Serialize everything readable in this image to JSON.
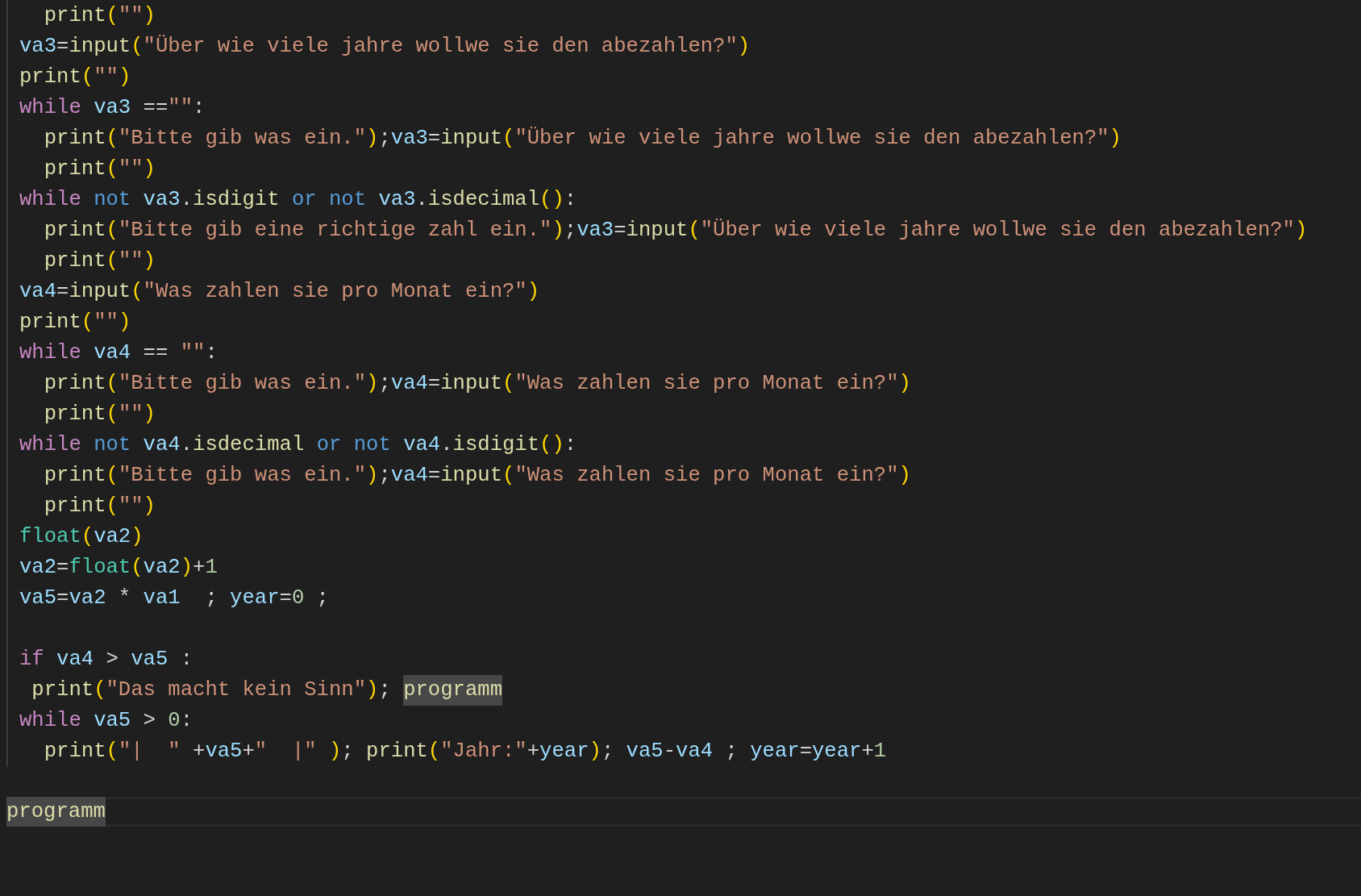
{
  "editor": {
    "lines": [
      {
        "kind": "code",
        "tokens": [
          {
            "kind": "fn",
            "text": "  print"
          },
          {
            "kind": "br",
            "text": "("
          },
          {
            "kind": "str",
            "text": "\"\""
          },
          {
            "kind": "br",
            "text": ")"
          }
        ]
      },
      {
        "kind": "code",
        "tokens": [
          {
            "kind": "var",
            "text": "va3"
          },
          {
            "kind": "p",
            "text": "="
          },
          {
            "kind": "fn",
            "text": "input"
          },
          {
            "kind": "br",
            "text": "("
          },
          {
            "kind": "str",
            "text": "\"Über wie viele jahre wollwe sie den abezahlen?\""
          },
          {
            "kind": "br",
            "text": ")"
          }
        ]
      },
      {
        "kind": "code",
        "tokens": [
          {
            "kind": "fn",
            "text": "print"
          },
          {
            "kind": "br",
            "text": "("
          },
          {
            "kind": "str",
            "text": "\"\""
          },
          {
            "kind": "br",
            "text": ")"
          }
        ]
      },
      {
        "kind": "code",
        "tokens": [
          {
            "kind": "kw",
            "text": "while "
          },
          {
            "kind": "var",
            "text": "va3"
          },
          {
            "kind": "p",
            "text": " =="
          },
          {
            "kind": "str",
            "text": "\"\""
          },
          {
            "kind": "p",
            "text": ":"
          }
        ]
      },
      {
        "kind": "code",
        "tokens": [
          {
            "kind": "fn",
            "text": "  print"
          },
          {
            "kind": "br",
            "text": "("
          },
          {
            "kind": "str",
            "text": "\"Bitte gib was ein.\""
          },
          {
            "kind": "br",
            "text": ")"
          },
          {
            "kind": "p",
            "text": ";"
          },
          {
            "kind": "var",
            "text": "va3"
          },
          {
            "kind": "p",
            "text": "="
          },
          {
            "kind": "fn",
            "text": "input"
          },
          {
            "kind": "br",
            "text": "("
          },
          {
            "kind": "str",
            "text": "\"Über wie viele jahre wollwe sie den abezahlen?\""
          },
          {
            "kind": "br",
            "text": ")"
          }
        ]
      },
      {
        "kind": "code",
        "tokens": [
          {
            "kind": "fn",
            "text": "  print"
          },
          {
            "kind": "br",
            "text": "("
          },
          {
            "kind": "str",
            "text": "\"\""
          },
          {
            "kind": "br",
            "text": ")"
          }
        ]
      },
      {
        "kind": "code",
        "tokens": [
          {
            "kind": "kw",
            "text": "while "
          },
          {
            "kind": "op",
            "text": "not "
          },
          {
            "kind": "var",
            "text": "va3"
          },
          {
            "kind": "p",
            "text": "."
          },
          {
            "kind": "fn",
            "text": "isdigit "
          },
          {
            "kind": "op",
            "text": "or not "
          },
          {
            "kind": "var",
            "text": "va3"
          },
          {
            "kind": "p",
            "text": "."
          },
          {
            "kind": "fn",
            "text": "isdecimal"
          },
          {
            "kind": "br",
            "text": "()"
          },
          {
            "kind": "p",
            "text": ":"
          }
        ]
      },
      {
        "kind": "code",
        "tokens": [
          {
            "kind": "fn",
            "text": "  print"
          },
          {
            "kind": "br",
            "text": "("
          },
          {
            "kind": "str",
            "text": "\"Bitte gib eine richtige zahl ein.\""
          },
          {
            "kind": "br",
            "text": ")"
          },
          {
            "kind": "p",
            "text": ";"
          },
          {
            "kind": "var",
            "text": "va3"
          },
          {
            "kind": "p",
            "text": "="
          },
          {
            "kind": "fn",
            "text": "input"
          },
          {
            "kind": "br",
            "text": "("
          },
          {
            "kind": "str",
            "text": "\"Über wie viele jahre wollwe sie den abezahlen?\""
          },
          {
            "kind": "br",
            "text": ")"
          }
        ]
      },
      {
        "kind": "code",
        "tokens": [
          {
            "kind": "fn",
            "text": "  print"
          },
          {
            "kind": "br",
            "text": "("
          },
          {
            "kind": "str",
            "text": "\"\""
          },
          {
            "kind": "br",
            "text": ")"
          }
        ]
      },
      {
        "kind": "code",
        "tokens": [
          {
            "kind": "var",
            "text": "va4"
          },
          {
            "kind": "p",
            "text": "="
          },
          {
            "kind": "fn",
            "text": "input"
          },
          {
            "kind": "br",
            "text": "("
          },
          {
            "kind": "str",
            "text": "\"Was zahlen sie pro Monat ein?\""
          },
          {
            "kind": "br",
            "text": ")"
          }
        ]
      },
      {
        "kind": "code",
        "tokens": [
          {
            "kind": "fn",
            "text": "print"
          },
          {
            "kind": "br",
            "text": "("
          },
          {
            "kind": "str",
            "text": "\"\""
          },
          {
            "kind": "br",
            "text": ")"
          }
        ]
      },
      {
        "kind": "code",
        "tokens": [
          {
            "kind": "kw",
            "text": "while "
          },
          {
            "kind": "var",
            "text": "va4"
          },
          {
            "kind": "p",
            "text": " == "
          },
          {
            "kind": "str",
            "text": "\"\""
          },
          {
            "kind": "p",
            "text": ":"
          }
        ]
      },
      {
        "kind": "code",
        "tokens": [
          {
            "kind": "fn",
            "text": "  print"
          },
          {
            "kind": "br",
            "text": "("
          },
          {
            "kind": "str",
            "text": "\"Bitte gib was ein.\""
          },
          {
            "kind": "br",
            "text": ")"
          },
          {
            "kind": "p",
            "text": ";"
          },
          {
            "kind": "var",
            "text": "va4"
          },
          {
            "kind": "p",
            "text": "="
          },
          {
            "kind": "fn",
            "text": "input"
          },
          {
            "kind": "br",
            "text": "("
          },
          {
            "kind": "str",
            "text": "\"Was zahlen sie pro Monat ein?\""
          },
          {
            "kind": "br",
            "text": ")"
          }
        ]
      },
      {
        "kind": "code",
        "tokens": [
          {
            "kind": "fn",
            "text": "  print"
          },
          {
            "kind": "br",
            "text": "("
          },
          {
            "kind": "str",
            "text": "\"\""
          },
          {
            "kind": "br",
            "text": ")"
          }
        ]
      },
      {
        "kind": "code",
        "tokens": [
          {
            "kind": "kw",
            "text": "while "
          },
          {
            "kind": "op",
            "text": "not "
          },
          {
            "kind": "var",
            "text": "va4"
          },
          {
            "kind": "p",
            "text": "."
          },
          {
            "kind": "fn",
            "text": "isdecimal "
          },
          {
            "kind": "op",
            "text": "or not "
          },
          {
            "kind": "var",
            "text": "va4"
          },
          {
            "kind": "p",
            "text": "."
          },
          {
            "kind": "fn",
            "text": "isdigit"
          },
          {
            "kind": "br",
            "text": "()"
          },
          {
            "kind": "p",
            "text": ":"
          }
        ]
      },
      {
        "kind": "code",
        "tokens": [
          {
            "kind": "fn",
            "text": "  print"
          },
          {
            "kind": "br",
            "text": "("
          },
          {
            "kind": "str",
            "text": "\"Bitte gib was ein.\""
          },
          {
            "kind": "br",
            "text": ")"
          },
          {
            "kind": "p",
            "text": ";"
          },
          {
            "kind": "var",
            "text": "va4"
          },
          {
            "kind": "p",
            "text": "="
          },
          {
            "kind": "fn",
            "text": "input"
          },
          {
            "kind": "br",
            "text": "("
          },
          {
            "kind": "str",
            "text": "\"Was zahlen sie pro Monat ein?\""
          },
          {
            "kind": "br",
            "text": ")"
          }
        ]
      },
      {
        "kind": "code",
        "tokens": [
          {
            "kind": "fn",
            "text": "  print"
          },
          {
            "kind": "br",
            "text": "("
          },
          {
            "kind": "str",
            "text": "\"\""
          },
          {
            "kind": "br",
            "text": ")"
          }
        ]
      },
      {
        "kind": "code",
        "tokens": [
          {
            "kind": "cls",
            "text": "float"
          },
          {
            "kind": "br",
            "text": "("
          },
          {
            "kind": "var",
            "text": "va2"
          },
          {
            "kind": "br",
            "text": ")"
          }
        ]
      },
      {
        "kind": "code",
        "tokens": [
          {
            "kind": "var",
            "text": "va2"
          },
          {
            "kind": "p",
            "text": "="
          },
          {
            "kind": "cls",
            "text": "float"
          },
          {
            "kind": "br",
            "text": "("
          },
          {
            "kind": "var",
            "text": "va2"
          },
          {
            "kind": "br",
            "text": ")"
          },
          {
            "kind": "p",
            "text": "+"
          },
          {
            "kind": "num",
            "text": "1"
          }
        ]
      },
      {
        "kind": "code",
        "tokens": [
          {
            "kind": "var",
            "text": "va5"
          },
          {
            "kind": "p",
            "text": "="
          },
          {
            "kind": "var",
            "text": "va2"
          },
          {
            "kind": "p",
            "text": " * "
          },
          {
            "kind": "var",
            "text": "va1"
          },
          {
            "kind": "p",
            "text": "  ; "
          },
          {
            "kind": "var",
            "text": "year"
          },
          {
            "kind": "p",
            "text": "="
          },
          {
            "kind": "num",
            "text": "0"
          },
          {
            "kind": "p",
            "text": " ;"
          }
        ]
      },
      {
        "kind": "blank"
      },
      {
        "kind": "code",
        "tokens": [
          {
            "kind": "kw",
            "text": "if "
          },
          {
            "kind": "var",
            "text": "va4"
          },
          {
            "kind": "p",
            "text": " > "
          },
          {
            "kind": "var",
            "text": "va5"
          },
          {
            "kind": "p",
            "text": " :"
          }
        ]
      },
      {
        "kind": "code",
        "tokens": [
          {
            "kind": "fn",
            "text": " print"
          },
          {
            "kind": "br",
            "text": "("
          },
          {
            "kind": "str",
            "text": "\"Das macht kein Sinn\""
          },
          {
            "kind": "br",
            "text": ")"
          },
          {
            "kind": "p",
            "text": "; "
          },
          {
            "kind": "hl",
            "text": "programm"
          }
        ]
      },
      {
        "kind": "code",
        "tokens": [
          {
            "kind": "kw",
            "text": "while "
          },
          {
            "kind": "var",
            "text": "va5"
          },
          {
            "kind": "p",
            "text": " > "
          },
          {
            "kind": "num",
            "text": "0"
          },
          {
            "kind": "p",
            "text": ":"
          }
        ]
      },
      {
        "kind": "code",
        "tokens": [
          {
            "kind": "fn",
            "text": "  print"
          },
          {
            "kind": "br",
            "text": "("
          },
          {
            "kind": "str",
            "text": "\"|  \""
          },
          {
            "kind": "p",
            "text": " +"
          },
          {
            "kind": "var",
            "text": "va5"
          },
          {
            "kind": "p",
            "text": "+"
          },
          {
            "kind": "str",
            "text": "\"  |\" "
          },
          {
            "kind": "br",
            "text": ")"
          },
          {
            "kind": "p",
            "text": "; "
          },
          {
            "kind": "fn",
            "text": "print"
          },
          {
            "kind": "br",
            "text": "("
          },
          {
            "kind": "str",
            "text": "\"Jahr:\""
          },
          {
            "kind": "p",
            "text": "+"
          },
          {
            "kind": "var",
            "text": "year"
          },
          {
            "kind": "br",
            "text": ")"
          },
          {
            "kind": "p",
            "text": "; "
          },
          {
            "kind": "var",
            "text": "va5"
          },
          {
            "kind": "p",
            "text": "-"
          },
          {
            "kind": "var",
            "text": "va4"
          },
          {
            "kind": "p",
            "text": " ; "
          },
          {
            "kind": "var",
            "text": "year"
          },
          {
            "kind": "p",
            "text": "="
          },
          {
            "kind": "var",
            "text": "year"
          },
          {
            "kind": "p",
            "text": "+"
          },
          {
            "kind": "num",
            "text": "1"
          }
        ]
      }
    ]
  },
  "bottom_line": {
    "text": "programm",
    "highlighted": true
  }
}
